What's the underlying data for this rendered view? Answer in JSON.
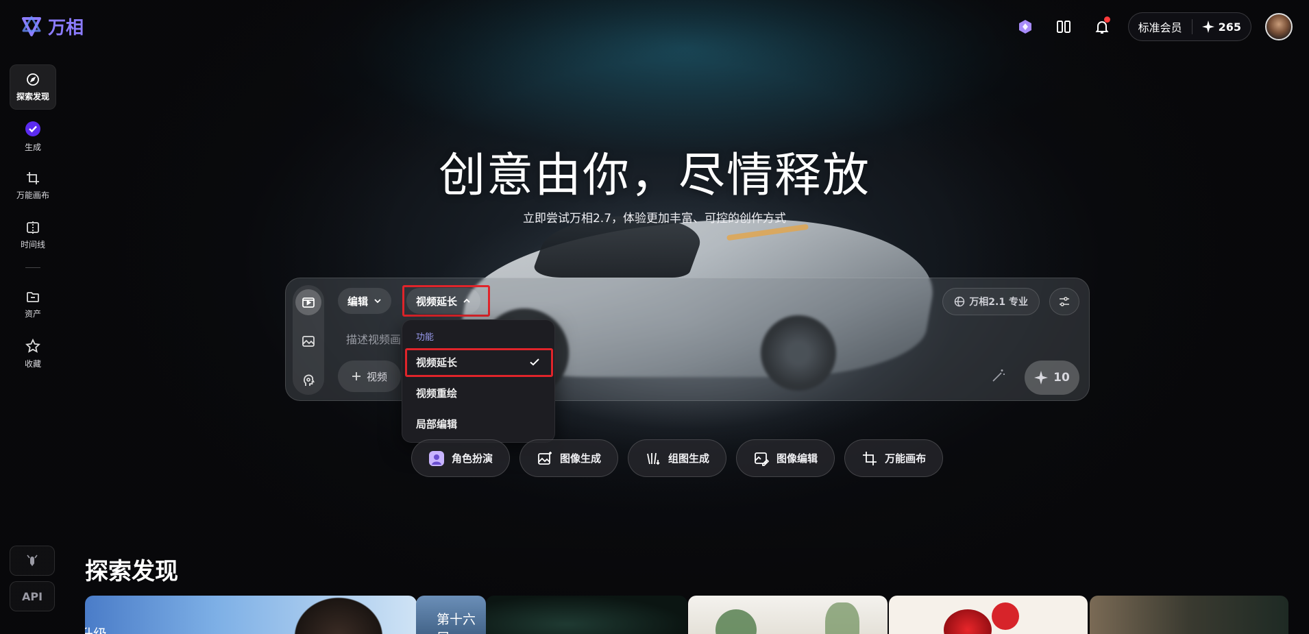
{
  "app": {
    "logo_text": "万相"
  },
  "header": {
    "membership": "标准会员",
    "credits": "265"
  },
  "sidebar": {
    "items": [
      {
        "label": "探索发现",
        "icon": "compass-icon"
      },
      {
        "label": "生成",
        "icon": "check-circle-icon"
      },
      {
        "label": "万能画布",
        "icon": "crop-icon"
      },
      {
        "label": "时间线",
        "icon": "timeline-icon"
      },
      {
        "label": "资产",
        "icon": "folder-icon"
      },
      {
        "label": "收藏",
        "icon": "star-icon"
      }
    ],
    "bottom": {
      "api_label": "API"
    }
  },
  "hero": {
    "title": "创意由你，尽情释放",
    "subtitle": "立即尝试万相2.7，体验更加丰富、可控的创作方式"
  },
  "composer": {
    "edit_label": "编辑",
    "mode_label": "视频延长",
    "prompt_placeholder": "描述视频画",
    "add_video_label": "视频",
    "model_label": "万相2.1 专业",
    "generate_cost": "10"
  },
  "dropdown": {
    "header": "功能",
    "items": [
      {
        "label": "视频延长",
        "selected": true
      },
      {
        "label": "视频重绘",
        "selected": false
      },
      {
        "label": "局部编辑",
        "selected": false
      }
    ]
  },
  "shortcuts": [
    {
      "label": "角色扮演",
      "icon": "role-play-icon"
    },
    {
      "label": "图像生成",
      "icon": "image-gen-icon"
    },
    {
      "label": "组图生成",
      "icon": "image-group-icon"
    },
    {
      "label": "图像编辑",
      "icon": "image-edit-icon"
    },
    {
      "label": "万能画布",
      "icon": "canvas-crop-icon"
    }
  ],
  "explore": {
    "title": "探索发现",
    "cards": [
      {
        "text": "升级"
      },
      {
        "text": "第十六届"
      },
      {
        "text": ""
      },
      {
        "text": ""
      },
      {
        "text": ""
      },
      {
        "text": ""
      }
    ]
  },
  "colors": {
    "accent": "#8c7cff",
    "highlight": "#e0242a",
    "notification": "#ff3b3b"
  }
}
